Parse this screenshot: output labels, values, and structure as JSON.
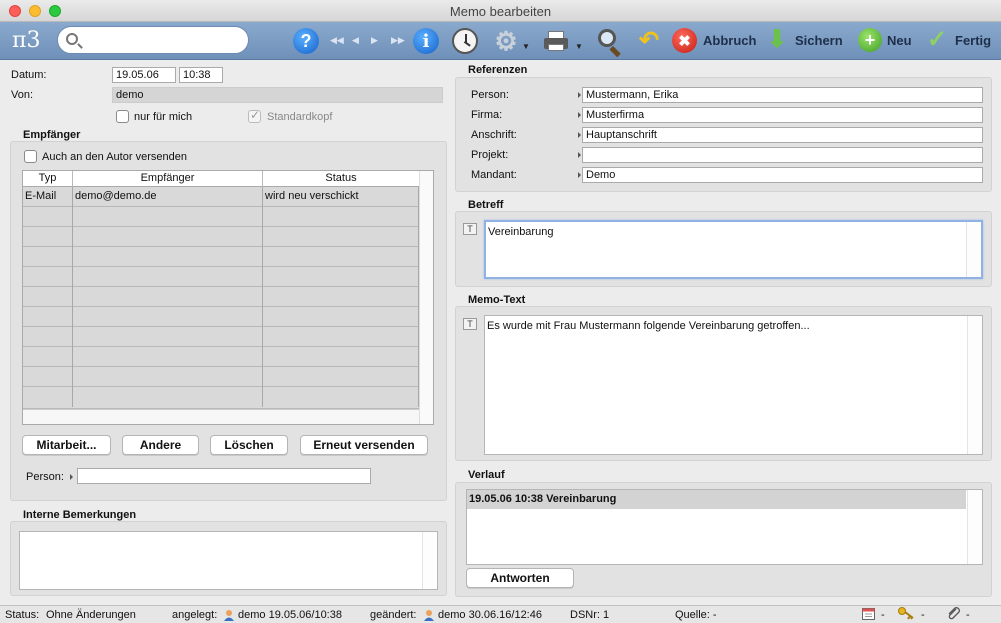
{
  "window": {
    "title": "Memo bearbeiten",
    "lights": [
      "#fc5f57",
      "#fdbc2e",
      "#2ac940"
    ]
  },
  "toolbar": {
    "logo": "π3",
    "search": {
      "value": "",
      "placeholder": ""
    },
    "buttons": {
      "abbruch": "Abbruch",
      "sichern": "Sichern",
      "neu": "Neu",
      "fertig": "Fertig"
    }
  },
  "header": {
    "datum_label": "Datum:",
    "datum": "19.05.06",
    "zeit": "10:38",
    "von_label": "Von:",
    "von": "demo",
    "nur_fuer_mich": "nur für mich",
    "standardkopf": "Standardkopf"
  },
  "empfaenger": {
    "title": "Empfänger",
    "auch_autor": "Auch an den Autor versenden",
    "columns": [
      "Typ",
      "Empfänger",
      "Status"
    ],
    "rows": [
      {
        "typ": "E-Mail",
        "empfaenger": "demo@demo.de",
        "status": "wird neu verschickt"
      }
    ],
    "buttons": {
      "mitarbeit": "Mitarbeit...",
      "andere": "Andere",
      "loeschen": "Löschen",
      "erneut": "Erneut versenden"
    },
    "person_label": "Person:",
    "person_value": ""
  },
  "interne": {
    "title": "Interne Bemerkungen",
    "text": ""
  },
  "referenzen": {
    "title": "Referenzen",
    "person_label": "Person:",
    "person": "Mustermann, Erika",
    "firma_label": "Firma:",
    "firma": "Musterfirma",
    "anschrift_label": "Anschrift:",
    "anschrift": "Hauptanschrift",
    "projekt_label": "Projekt:",
    "projekt": "",
    "mandant_label": "Mandant:",
    "mandant": "Demo"
  },
  "betreff": {
    "title": "Betreff",
    "text": "Vereinbarung"
  },
  "memo": {
    "title": "Memo-Text",
    "text": "Es wurde mit Frau Mustermann folgende Vereinbarung getroffen..."
  },
  "verlauf": {
    "title": "Verlauf",
    "entries": [
      "19.05.06 10:38 Vereinbarung"
    ],
    "antworten": "Antworten"
  },
  "status": {
    "status_label": "Status:",
    "status_value": "Ohne Änderungen",
    "angelegt_label": "angelegt:",
    "angelegt_value": "demo 19.05.06/10:38",
    "geaendert_label": "geändert:",
    "geaendert_value": "demo 30.06.16/12:46",
    "dsnr": "DSNr: 1",
    "quelle": "Quelle: -",
    "dash1": "-",
    "dash2": "-",
    "dash3": "-"
  }
}
